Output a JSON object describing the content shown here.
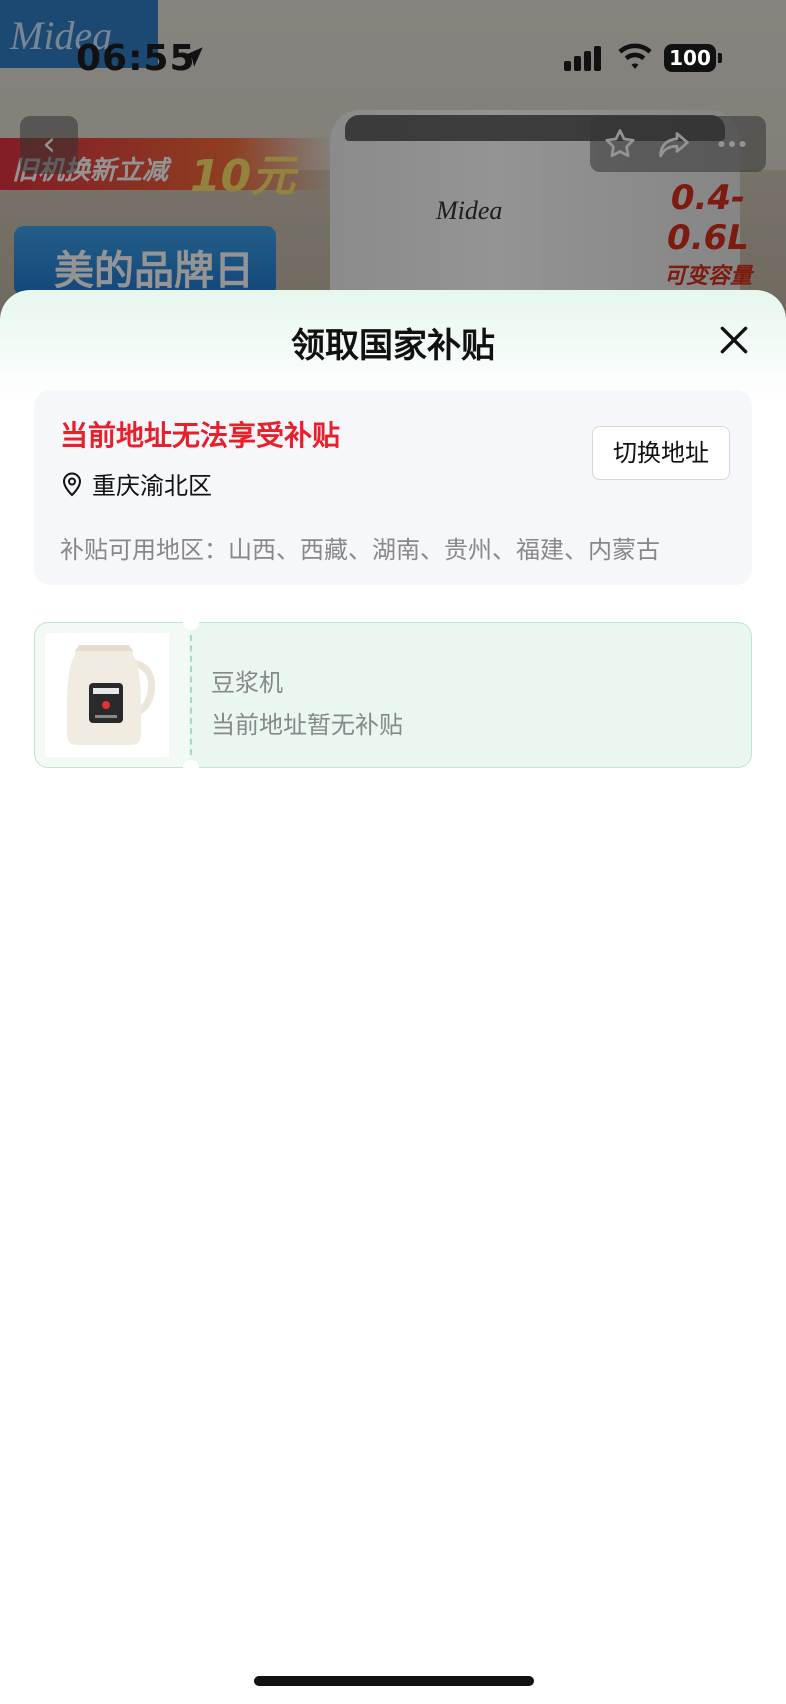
{
  "status_bar": {
    "time": "06:55",
    "battery": "100"
  },
  "background_page": {
    "brand_logo": "Midea",
    "promo_tradein": "旧机换新立减",
    "promo_tradein_amount": "10元",
    "promo_brand_day": "美的品牌日",
    "product_brand": "Midea",
    "capacity": "0.4-0.6L",
    "capacity_sub": "可变容量",
    "icons": [
      "back-icon",
      "star-icon",
      "share-icon",
      "more-icon"
    ]
  },
  "sheet": {
    "title": "领取国家补贴",
    "close_icon": "close-icon",
    "address_card": {
      "warning": "当前地址无法享受补贴",
      "location": "重庆渝北区",
      "switch_button": "切换地址",
      "available_regions": "补贴可用地区：山西、西藏、湖南、贵州、福建、内蒙古"
    },
    "product": {
      "name": "豆浆机",
      "status": "当前地址暂无补贴"
    }
  },
  "colors": {
    "warning_red": "#e8202b",
    "card_green": "#eaf7f0",
    "card_border_green": "#bfe6cf"
  }
}
